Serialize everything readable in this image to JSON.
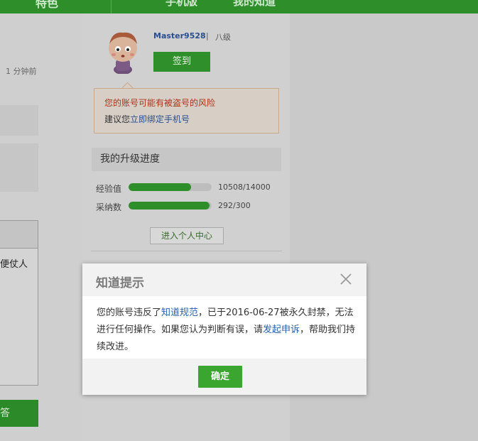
{
  "topbar": {
    "left_tab": "特色",
    "mobile_tab": "手机版",
    "mine_tab": "我的知道"
  },
  "left": {
    "time_ago": "1 分钟前",
    "panel_text": "便仗人",
    "answer_button": "答"
  },
  "profile": {
    "username": "Master9528",
    "separator": "|",
    "level": "八级",
    "signin_label": "签到"
  },
  "warning": {
    "line1": "您的账号可能有被盗号的风险",
    "line2_prefix": "建议您",
    "line2_link": "立即绑定手机号"
  },
  "progress": {
    "title": "我的升级进度",
    "rows": [
      {
        "label": "经验值",
        "value_text": "10508/14000",
        "fraction": 0.75
      },
      {
        "label": "采纳数",
        "value_text": "292/300",
        "fraction": 0.973
      }
    ],
    "center_button": "进入个人中心"
  },
  "modal": {
    "title": "知道提示",
    "body_part1": "您的账号违反了",
    "body_link1": "知道规范",
    "body_part2": "，已于2016-06-27被永久封禁，无法进行任何操作。如果您认为判断有误，请",
    "body_link2": "发起申诉",
    "body_part3": "，帮助我们持续改进。",
    "ok_label": "确定"
  },
  "colors": {
    "brand_green": "#2e8f2a",
    "button_green": "#3aa52f",
    "link_blue": "#2a61a8",
    "warning_red": "#a8341e"
  }
}
